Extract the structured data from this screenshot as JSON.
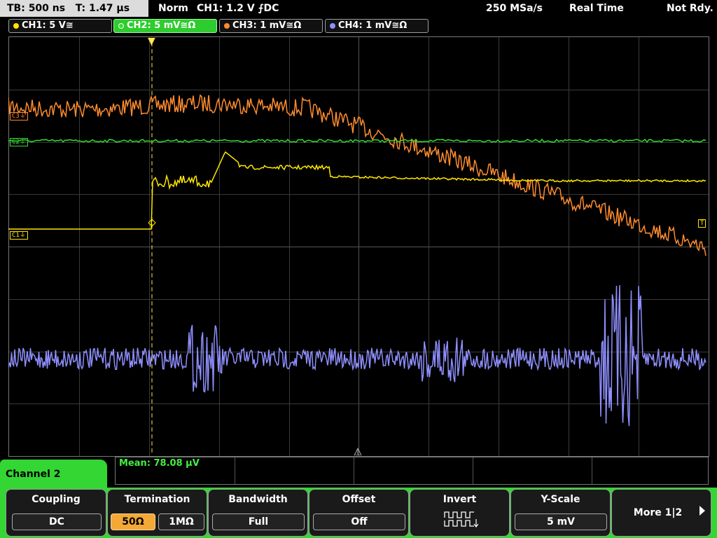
{
  "status": {
    "timebase": "TB: 500 ns",
    "trigger_time": "T: 1.47 µs",
    "mode": "Norm",
    "trigger_info": "CH1: 1.2 V ⨍DC",
    "sample_rate": "250 MSa/s",
    "acq": "Real Time",
    "ready": "Not Rdy."
  },
  "channels": [
    {
      "label": "CH1: 5 V≅",
      "color": "#ffe600"
    },
    {
      "label": "CH2: 5 mV≅Ω",
      "color": "#33dd33"
    },
    {
      "label": "CH3: 1 mV≅Ω",
      "color": "#ff8c2e"
    },
    {
      "label": "CH4: 1 mV≅Ω",
      "color": "#8f8fff"
    }
  ],
  "markers": {
    "c1": "C1",
    "c2": "C2",
    "c3": "C3"
  },
  "measurement": {
    "text": "Mean: 78.08 µV"
  },
  "panel": {
    "title": "Channel 2"
  },
  "menu": {
    "coupling": {
      "title": "Coupling",
      "value": "DC"
    },
    "termination": {
      "title": "Termination",
      "opt1": "50Ω",
      "opt2": "1MΩ"
    },
    "bandwidth": {
      "title": "Bandwidth",
      "value": "Full"
    },
    "offset": {
      "title": "Offset",
      "value": "Off"
    },
    "invert": {
      "title": "Invert"
    },
    "yscale": {
      "title": "Y-Scale",
      "value": "5 mV"
    },
    "more": {
      "label": "More 1|2"
    }
  }
}
